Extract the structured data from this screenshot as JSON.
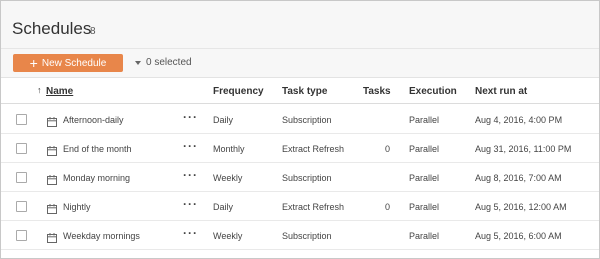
{
  "header": {
    "title": "Schedules",
    "count": "8"
  },
  "toolbar": {
    "new_button_label": "New Schedule",
    "selected_label": "0 selected",
    "accent_color": "#e8864a"
  },
  "table": {
    "columns": {
      "name": "Name",
      "frequency": "Frequency",
      "task_type": "Task type",
      "tasks": "Tasks",
      "execution": "Execution",
      "next_run": "Next run at"
    },
    "sort_indicator": "↑",
    "rows": [
      {
        "name": "Afternoon-daily",
        "frequency": "Daily",
        "task_type": "Subscription",
        "tasks": "",
        "execution": "Parallel",
        "next_run": "Aug 4, 2016, 4:00 PM"
      },
      {
        "name": "End of the month",
        "frequency": "Monthly",
        "task_type": "Extract Refresh",
        "tasks": "0",
        "execution": "Parallel",
        "next_run": "Aug 31, 2016, 11:00 PM"
      },
      {
        "name": "Monday morning",
        "frequency": "Weekly",
        "task_type": "Subscription",
        "tasks": "",
        "execution": "Parallel",
        "next_run": "Aug 8, 2016, 7:00 AM"
      },
      {
        "name": "Nightly",
        "frequency": "Daily",
        "task_type": "Extract Refresh",
        "tasks": "0",
        "execution": "Parallel",
        "next_run": "Aug 5, 2016, 12:00 AM"
      },
      {
        "name": "Weekday mornings",
        "frequency": "Weekly",
        "task_type": "Subscription",
        "tasks": "",
        "execution": "Parallel",
        "next_run": "Aug 5, 2016, 6:00 AM"
      }
    ]
  }
}
